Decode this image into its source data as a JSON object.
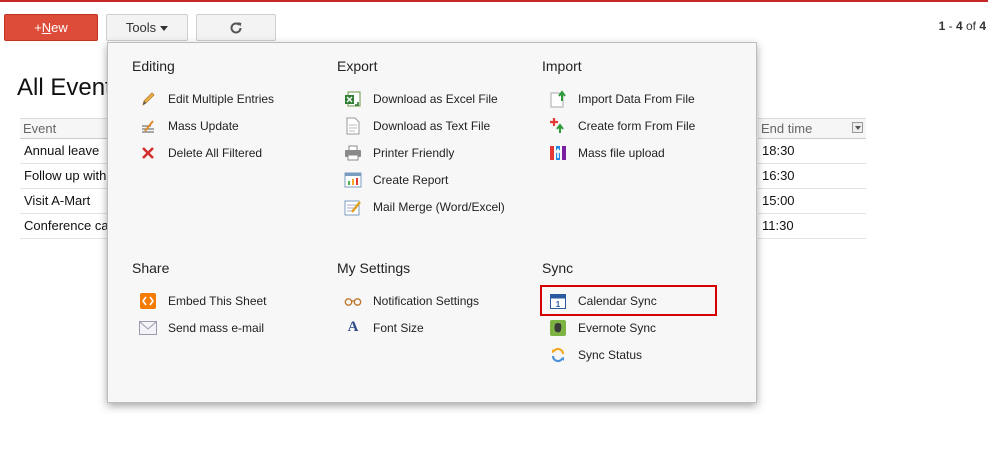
{
  "toolbar": {
    "new_prefix": "+",
    "new_underlined": "N",
    "new_rest": "ew",
    "tools_label": "Tools",
    "refresh_icon": "refresh-icon"
  },
  "pager": {
    "start": "1",
    "sep": " - ",
    "end": "4",
    "of": " of ",
    "total": "4"
  },
  "page": {
    "title": "All Events"
  },
  "table": {
    "col_event": "Event",
    "col_end": "End time",
    "events": [
      "Annual leave",
      "Follow up with",
      "Visit A-Mart",
      "Conference call"
    ],
    "end_times": [
      "18:30",
      "16:30",
      "15:00",
      "11:30"
    ]
  },
  "menu": {
    "editing": {
      "title": "Editing",
      "items": [
        {
          "label": "Edit Multiple Entries",
          "icon": "pencil-icon"
        },
        {
          "label": "Mass Update",
          "icon": "mass-update-icon"
        },
        {
          "label": "Delete All Filtered",
          "icon": "delete-x-icon"
        }
      ]
    },
    "export": {
      "title": "Export",
      "items": [
        {
          "label": "Download as Excel File",
          "icon": "excel-icon"
        },
        {
          "label": "Download as Text File",
          "icon": "text-file-icon"
        },
        {
          "label": "Printer Friendly",
          "icon": "printer-icon"
        },
        {
          "label": "Create Report",
          "icon": "report-icon"
        },
        {
          "label": "Mail Merge (Word/Excel)",
          "icon": "mail-merge-icon"
        }
      ]
    },
    "import": {
      "title": "Import",
      "items": [
        {
          "label": "Import Data From File",
          "icon": "import-file-icon"
        },
        {
          "label": "Create form From File",
          "icon": "create-form-icon"
        },
        {
          "label": "Mass file upload",
          "icon": "mass-upload-icon"
        }
      ]
    },
    "share": {
      "title": "Share",
      "items": [
        {
          "label": "Embed This Sheet",
          "icon": "embed-icon"
        },
        {
          "label": "Send mass e-mail",
          "icon": "envelope-icon"
        }
      ]
    },
    "settings": {
      "title": "My Settings",
      "items": [
        {
          "label": "Notification Settings",
          "icon": "glasses-icon"
        },
        {
          "label": "Font Size",
          "icon": "font-icon"
        }
      ]
    },
    "sync": {
      "title": "Sync",
      "items": [
        {
          "label": "Calendar Sync",
          "icon": "calendar-icon",
          "highlighted": true
        },
        {
          "label": "Evernote Sync",
          "icon": "evernote-icon"
        },
        {
          "label": "Sync Status",
          "icon": "sync-status-icon"
        }
      ]
    }
  },
  "colors": {
    "accent_red": "#dd4b39",
    "highlight_border": "#d50000",
    "menu_bg": "#f7f7f7"
  }
}
